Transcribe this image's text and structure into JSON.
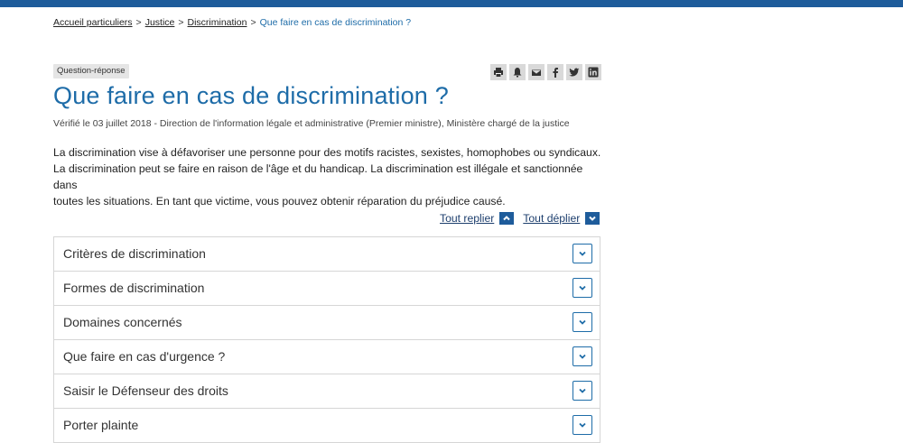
{
  "breadcrumb": {
    "items": [
      "Accueil particuliers",
      "Justice",
      "Discrimination"
    ],
    "separator": ">",
    "current": "Que faire en cas de discrimination ?"
  },
  "badge": "Question-réponse",
  "share_icons": [
    "print-icon",
    "bell-icon",
    "mail-icon",
    "facebook-icon",
    "twitter-icon",
    "linkedin-icon"
  ],
  "title": "Que faire en cas de discrimination ?",
  "verified": "Vérifié le 03 juillet 2018 - Direction de l'information légale et administrative (Premier ministre), Ministère chargé de la justice",
  "intro": {
    "line1": "La discrimination vise à défavoriser une personne pour des motifs racistes, sexistes, homophobes ou syndicaux.",
    "line2": "La discrimination peut se faire en raison de l'âge et du handicap. La discrimination est illégale et sanctionnée dans",
    "line3": "toutes les situations. En tant que victime, vous pouvez obtenir réparation du préjudice causé."
  },
  "toggles": {
    "collapse_all": "Tout replier",
    "expand_all": "Tout déplier"
  },
  "accordion": [
    "Critères de discrimination",
    "Formes de discrimination",
    "Domaines concernés",
    "Que faire en cas d'urgence ?",
    "Saisir le Défenseur des droits",
    "Porter plainte"
  ],
  "colors": {
    "brand_blue": "#1e5c9b",
    "title_blue": "#1e6ca8"
  }
}
